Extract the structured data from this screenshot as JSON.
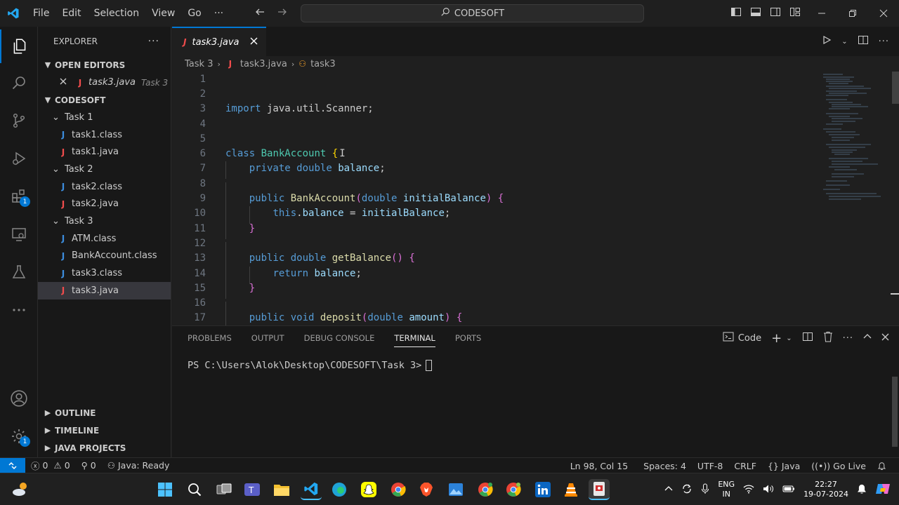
{
  "titlebar": {
    "menu": [
      "File",
      "Edit",
      "Selection",
      "View",
      "Go",
      "···"
    ],
    "search_text": "CODESOFT"
  },
  "colors": {
    "accent": "#0078d4",
    "background": "#1f1f1f",
    "sidebar": "#181818"
  },
  "activitybar": {
    "extensions_badge": "1",
    "settings_badge": "1"
  },
  "sidebar": {
    "title": "EXPLORER",
    "open_editors": {
      "label": "OPEN EDITORS",
      "item_name": "task3.java",
      "item_folder": "Task 3"
    },
    "workspace": "CODESOFT",
    "folders": [
      {
        "name": "Task 1",
        "files": [
          {
            "name": "task1.class",
            "kind": "class"
          },
          {
            "name": "task1.java",
            "kind": "java"
          }
        ]
      },
      {
        "name": "Task 2",
        "files": [
          {
            "name": "task2.class",
            "kind": "class"
          },
          {
            "name": "task2.java",
            "kind": "java"
          }
        ]
      },
      {
        "name": "Task 3",
        "files": [
          {
            "name": "ATM.class",
            "kind": "class"
          },
          {
            "name": "BankAccount.class",
            "kind": "class"
          },
          {
            "name": "task3.class",
            "kind": "class"
          },
          {
            "name": "task3.java",
            "kind": "java"
          }
        ]
      }
    ],
    "bottom_sections": [
      "OUTLINE",
      "TIMELINE",
      "JAVA PROJECTS"
    ]
  },
  "editor": {
    "tab_label": "task3.java",
    "breadcrumb": [
      "Task 3",
      "task3.java",
      "task3"
    ],
    "line_numbers": [
      "1",
      "2",
      "3",
      "4",
      "5",
      "6",
      "7",
      "8",
      "9",
      "10",
      "11",
      "12",
      "13",
      "14",
      "15",
      "16",
      "17"
    ],
    "code": {
      "l3_a": "import",
      "l3_b": " java.util.Scanner;",
      "l6_a": "class",
      "l6_b": "BankAccount",
      "l6_c": "{",
      "l7_a": "private",
      "l7_b": "double",
      "l7_c": "balance",
      "l7_d": ";",
      "l9_a": "public",
      "l9_b": "BankAccount",
      "l9_c": "(",
      "l9_d": "double",
      "l9_e": "initialBalance",
      "l9_f": ")",
      "l9_g": "{",
      "l10_a": "this",
      "l10_b": ".",
      "l10_c": "balance",
      "l10_d": " = ",
      "l10_e": "initialBalance",
      "l10_f": ";",
      "l11_a": "}",
      "l13_a": "public",
      "l13_b": "double",
      "l13_c": "getBalance",
      "l13_d": "()",
      "l13_e": "{",
      "l14_a": "return",
      "l14_b": "balance",
      "l14_c": ";",
      "l15_a": "}",
      "l17_a": "public",
      "l17_b": "void",
      "l17_c": "deposit",
      "l17_d": "(",
      "l17_e": "double",
      "l17_f": "amount",
      "l17_g": ")",
      "l17_h": "{"
    }
  },
  "panel": {
    "tabs": [
      "PROBLEMS",
      "OUTPUT",
      "DEBUG CONSOLE",
      "TERMINAL",
      "PORTS"
    ],
    "active_tab": "TERMINAL",
    "terminal_name": "Code",
    "prompt": "PS C:\\Users\\Alok\\Desktop\\CODESOFT\\Task 3>"
  },
  "statusbar": {
    "errors": "0",
    "warnings": "0",
    "ports": "0",
    "java_status": "Java: Ready",
    "cursor_pos": "Ln 98, Col 15",
    "spaces": "Spaces: 4",
    "encoding": "UTF-8",
    "eol": "CRLF",
    "language": "Java",
    "go_live": "Go Live"
  },
  "taskbar": {
    "lang_top": "ENG",
    "lang_bottom": "IN",
    "time": "22:27",
    "date": "19-07-2024"
  }
}
